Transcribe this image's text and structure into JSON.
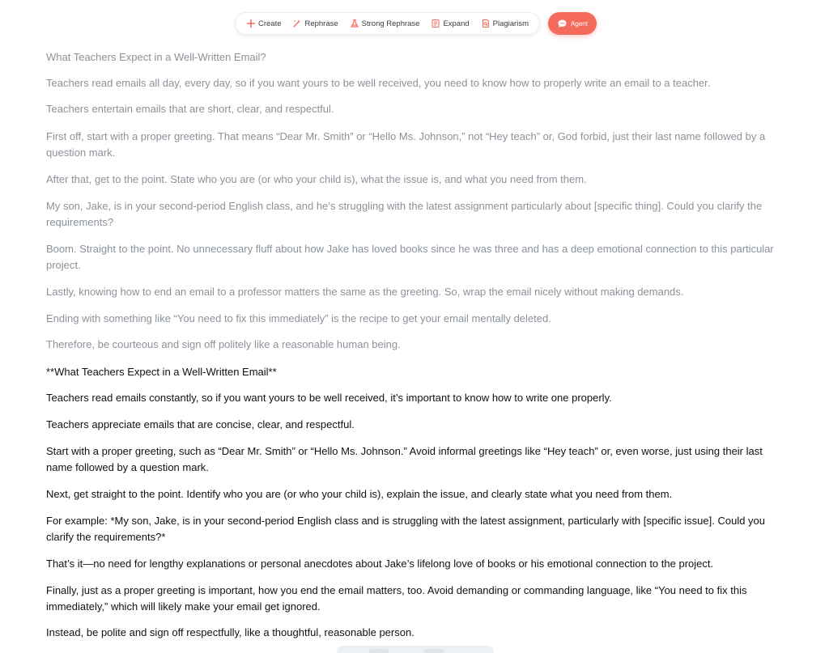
{
  "toolbar": {
    "items": [
      {
        "label": "Create",
        "icon": "plus-icon"
      },
      {
        "label": "Rephrase",
        "icon": "rephrase-icon"
      },
      {
        "label": "Strong Rephrase",
        "icon": "strong-rephrase-icon"
      },
      {
        "label": "Expand",
        "icon": "expand-icon"
      },
      {
        "label": "Plagiarism",
        "icon": "plagiarism-icon"
      }
    ],
    "agent_label": "Agent"
  },
  "colors": {
    "accent": "#f46b5b",
    "original_text": "#8b929a",
    "rewritten_text": "#111111"
  },
  "original": [
    "What Teachers Expect in a Well-Written Email?",
    "Teachers read emails all day, every day, so if you want yours to be well received, you need to know how to properly write an email to a teacher.",
    "Teachers entertain emails that are short, clear, and respectful.",
    "First off, start with a proper greeting. That means “Dear Mr. Smith” or “Hello Ms. Johnson,” not “Hey teach” or, God forbid, just their last name followed by a question mark.",
    "After that, get to the point. State who you are (or who your child is), what the issue is, and what you need from them.",
    "My son, Jake, is in your second-period English class, and he’s struggling with the latest assignment particularly about [specific thing]. Could you clarify the requirements?",
    "Boom. Straight to the point. No unnecessary fluff about how Jake has loved books since he was three and has a deep emotional connection to this particular project.",
    "Lastly, knowing how to end an email to a professor matters the same as the greeting. So, wrap the email nicely without making demands.",
    "Ending with something like “You need to fix this immediately” is the recipe to get your email mentally deleted.",
    "Therefore, be courteous and sign off politely like a reasonable human being."
  ],
  "rewritten": [
    "**What Teachers Expect in a Well-Written Email**",
    "Teachers read emails constantly, so if you want yours to be well received, it’s important to know how to write one properly.",
    "Teachers appreciate emails that are concise, clear, and respectful.",
    "Start with a proper greeting, such as “Dear Mr. Smith” or “Hello Ms. Johnson.” Avoid informal greetings like “Hey teach” or, even worse, just using their last name followed by a question mark.",
    "Next, get straight to the point. Identify who you are (or who your child is), explain the issue, and clearly state what you need from them.",
    "For example: *My son, Jake, is in your second-period English class and is struggling with the latest assignment, particularly with [specific issue]. Could you clarify the requirements?*",
    "That’s it—no need for lengthy explanations or personal anecdotes about Jake’s lifelong love of books or his emotional connection to the project.",
    "Finally, just as a proper greeting is important, how you end the email matters, too. Avoid demanding or commanding language, like “You need to fix this immediately,” which will likely make your email get ignored.",
    "Instead, be polite and sign off respectfully, like a thoughtful, reasonable person."
  ]
}
